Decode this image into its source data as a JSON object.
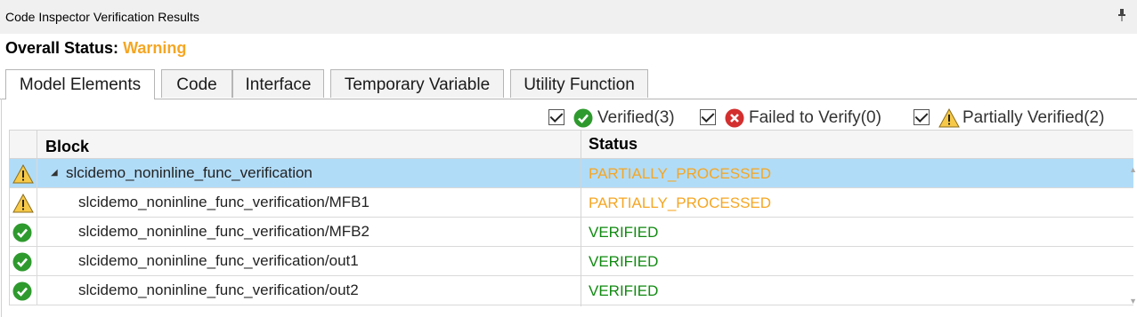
{
  "window": {
    "title": "Code Inspector Verification Results",
    "pin_icon": "pin-icon"
  },
  "overall": {
    "label": "Overall Status:",
    "value": "Warning",
    "value_color": "#f5a623"
  },
  "tabs": [
    {
      "label": "Model Elements",
      "active": true
    },
    {
      "label": "Code",
      "active": false
    },
    {
      "label": "Interface",
      "active": false
    },
    {
      "label": "Temporary Variable",
      "active": false
    },
    {
      "label": "Utility Function",
      "active": false
    }
  ],
  "filters": [
    {
      "label": "Verified(3)",
      "checked": true,
      "icon": "verified-icon"
    },
    {
      "label": "Failed to Verify(0)",
      "checked": true,
      "icon": "failed-icon"
    },
    {
      "label": "Partially Verified(2)",
      "checked": true,
      "icon": "warning-icon"
    }
  ],
  "table": {
    "columns": [
      "Block",
      "Status"
    ],
    "rows": [
      {
        "icon": "warning-icon",
        "name": "slcidemo_noninline_func_verification",
        "status": "PARTIALLY_PROCESSED",
        "status_color": "#f5a623",
        "expanded": true,
        "selected": true,
        "level": 0
      },
      {
        "icon": "warning-icon",
        "name": "slcidemo_noninline_func_verification/MFB1",
        "status": "PARTIALLY_PROCESSED",
        "status_color": "#f5a623",
        "selected": false,
        "level": 1
      },
      {
        "icon": "verified-icon",
        "name": "slcidemo_noninline_func_verification/MFB2",
        "status": "VERIFIED",
        "status_color": "#108a10",
        "selected": false,
        "level": 1
      },
      {
        "icon": "verified-icon",
        "name": "slcidemo_noninline_func_verification/out1",
        "status": "VERIFIED",
        "status_color": "#108a10",
        "selected": false,
        "level": 1
      },
      {
        "icon": "verified-icon",
        "name": "slcidemo_noninline_func_verification/out2",
        "status": "VERIFIED",
        "status_color": "#108a10",
        "selected": false,
        "level": 1
      }
    ]
  }
}
